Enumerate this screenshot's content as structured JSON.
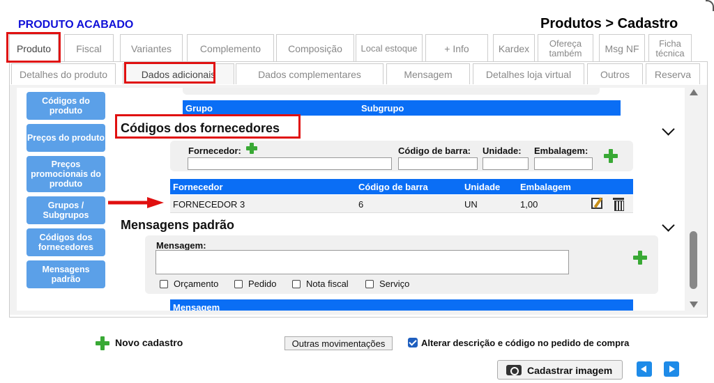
{
  "header": {
    "product_type": "PRODUTO ACABADO",
    "breadcrumb": "Produtos > Cadastro"
  },
  "main_tabs": [
    {
      "label": "Produto"
    },
    {
      "label": "Fiscal"
    },
    {
      "label": "Variantes"
    },
    {
      "label": "Complemento"
    },
    {
      "label": "Composição"
    },
    {
      "label": "Local estoque"
    },
    {
      "label": "+ Info"
    },
    {
      "label": "Kardex"
    },
    {
      "label": "Ofereça também"
    },
    {
      "label": "Msg NF"
    },
    {
      "label": "Ficha técnica"
    }
  ],
  "sub_tabs": [
    {
      "label": "Detalhes do produto"
    },
    {
      "label": "Dados adicionais"
    },
    {
      "label": "Dados complementares"
    },
    {
      "label": "Mensagem"
    },
    {
      "label": "Detalhes loja virtual"
    },
    {
      "label": "Outros"
    },
    {
      "label": "Reserva"
    }
  ],
  "sidebar": {
    "items": [
      {
        "label": "Códigos do produto"
      },
      {
        "label": "Preços do produto"
      },
      {
        "label": "Preços promocionais do produto"
      },
      {
        "label": "Grupos / Subgrupos"
      },
      {
        "label": "Códigos dos fornecedores"
      },
      {
        "label": "Mensagens padrão"
      }
    ]
  },
  "groups": {
    "col_group": "Grupo",
    "col_subgroup": "Subgrupo"
  },
  "suppliers": {
    "title": "Códigos dos fornecedores",
    "form": {
      "supplier_label": "Fornecedor:",
      "barcode_label": "Código de barra:",
      "unit_label": "Unidade:",
      "package_label": "Embalagem:",
      "supplier_value": "",
      "barcode_value": "",
      "unit_value": "",
      "package_value": ""
    },
    "table": {
      "headers": [
        "Fornecedor",
        "Código de barra",
        "Unidade",
        "Embalagem"
      ],
      "rows": [
        {
          "supplier": "FORNECEDOR 3",
          "barcode": "6",
          "unit": "UN",
          "package": "1,00"
        }
      ]
    }
  },
  "messages": {
    "title": "Mensagens padrão",
    "message_label": "Mensagem:",
    "message_value": "",
    "options": [
      {
        "label": "Orçamento"
      },
      {
        "label": "Pedido"
      },
      {
        "label": "Nota fiscal"
      },
      {
        "label": "Serviço"
      }
    ],
    "table_header": "Mensagem"
  },
  "footer": {
    "new_record": "Novo cadastro",
    "other_moves": "Outras movimentações",
    "alter_desc": "Alterar descrição e código no pedido de compra",
    "register_image": "Cadastrar imagem"
  },
  "colors": {
    "accent_blue": "#0a6ef5",
    "sidebar_blue": "#5ba0e8",
    "highlight_red": "#e01010",
    "plus_green": "#39a935"
  }
}
